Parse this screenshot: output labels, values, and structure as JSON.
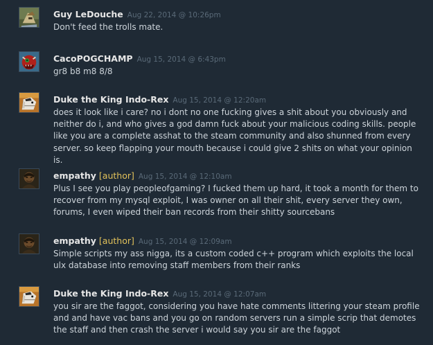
{
  "comments": [
    {
      "author": "Guy LeDouche",
      "author_tag": "",
      "timestamp": "Aug 22, 2014 @ 10:26pm",
      "text": "Don't feed the trolls mate.",
      "avatar_icon": "soldier-avatar-icon"
    },
    {
      "author": "CacoPOGCHAMP",
      "author_tag": "",
      "timestamp": "Aug 15, 2014 @ 6:43pm",
      "text": "gr8 b8 m8 8/8",
      "avatar_icon": "red-demon-avatar-icon"
    },
    {
      "author": "Duke the King Indo-Rex",
      "author_tag": "",
      "timestamp": "Aug 15, 2014 @ 12:20am",
      "text": "does it look like i care? no i dont no one fucking gives a shit about you obviously and neither do i, and who gives a god damn fuck about your malicious coding skills. people like you are a complete asshat to the steam community and also shunned from every server. so keep flapping your mouth because i could give 2 shits on what your opinion is.",
      "avatar_icon": "dinosaur-avatar-icon"
    },
    {
      "author": "empathy",
      "author_tag": "[author]",
      "timestamp": "Aug 15, 2014 @ 12:10am",
      "text": "Plus I see you play peopleofgaming? I fucked them up hard, it took a month for them to recover from my mysql exploit, I was owner on all their shit, every server they own, forums, I even wiped their ban records from their shitty sourcebans",
      "avatar_icon": "dark-figure-avatar-icon"
    },
    {
      "author": "empathy",
      "author_tag": "[author]",
      "timestamp": "Aug 15, 2014 @ 12:09am",
      "text": "Simple scripts my ass nigga, its a custom coded c++ program which exploits the local ulx database into removing staff members from their ranks",
      "avatar_icon": "dark-figure-avatar-icon"
    },
    {
      "author": "Duke the King Indo-Rex",
      "author_tag": "",
      "timestamp": "Aug 15, 2014 @ 12:07am",
      "text": "you sir are the faggot, considering you have hate comments littering your steam profile and and have vac bans and you go on random servers run a simple scrip that demotes the staff and then crash the server i would say you sir are the faggot",
      "avatar_icon": "dinosaur-avatar-icon"
    }
  ]
}
